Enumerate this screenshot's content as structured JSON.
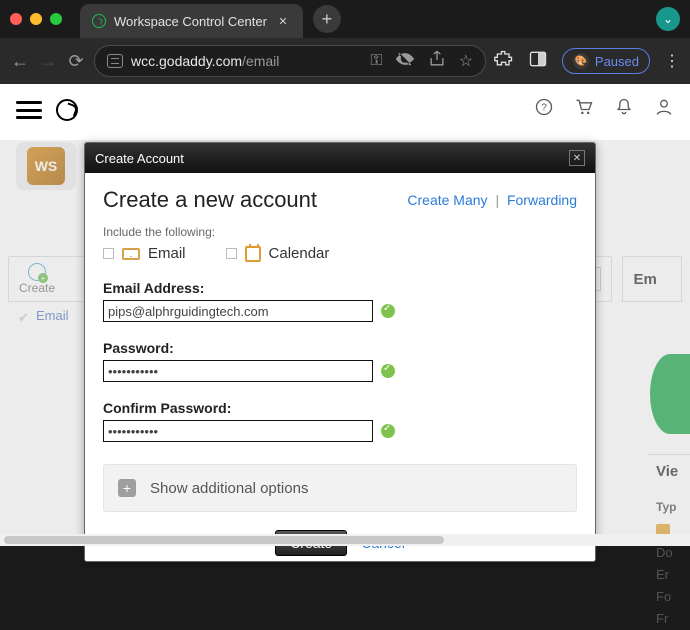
{
  "browser": {
    "tab_title": "Workspace Control Center",
    "url_host": "wcc.godaddy.com",
    "url_path": "/email",
    "paused_label": "Paused"
  },
  "header_icons": {
    "help": "help",
    "cart": "cart",
    "bell": "notifications",
    "user": "profile"
  },
  "account_chip": {
    "initials": "WS"
  },
  "list": {
    "create_label": "Create",
    "email_col": "Email",
    "panel_heading": "Em",
    "view_heading": "Vie",
    "type_label": "Typ",
    "row_dom": "Do",
    "row_em": "Er",
    "row_for": "Fo",
    "row_fr": "Fr"
  },
  "modal": {
    "header": "Create Account",
    "title": "Create a new account",
    "link_create_many": "Create Many",
    "link_forwarding": "Forwarding",
    "include_label": "Include the following:",
    "include_email": "Email",
    "include_calendar": "Calendar",
    "field_email_label": "Email Address:",
    "field_email_value": "pips@alphrguidingtech.com",
    "field_password_label": "Password:",
    "field_password_value": "•••••••••••",
    "field_confirm_label": "Confirm Password:",
    "field_confirm_value": "•••••••••••",
    "show_additional": "Show additional options",
    "btn_create": "Create",
    "btn_cancel": "Cancel"
  }
}
